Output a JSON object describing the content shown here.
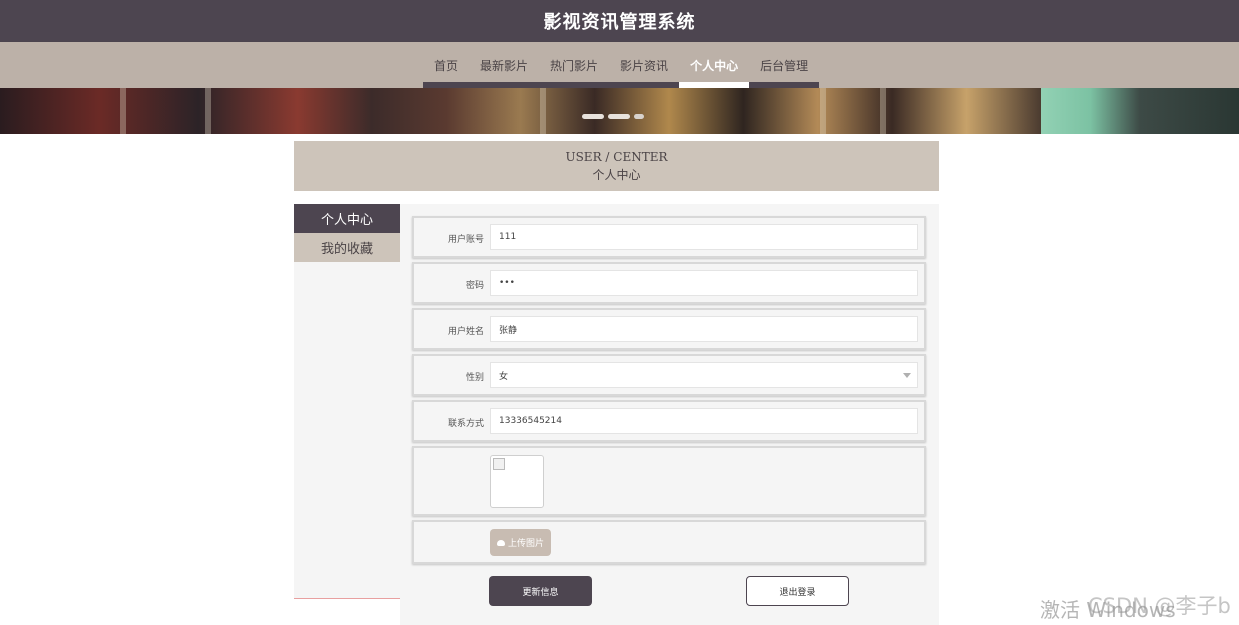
{
  "header": {
    "title": "影视资讯管理系统"
  },
  "nav": {
    "items": [
      {
        "label": "首页"
      },
      {
        "label": "最新影片"
      },
      {
        "label": "热门影片"
      },
      {
        "label": "影片资讯"
      },
      {
        "label": "个人中心"
      },
      {
        "label": "后台管理"
      }
    ],
    "active_index": 4
  },
  "banner": {
    "indicator_count": 3
  },
  "center": {
    "title_en": "USER / CENTER",
    "title_zh": "个人中心"
  },
  "sidebar": {
    "items": [
      {
        "label": "个人中心"
      },
      {
        "label": "我的收藏"
      }
    ]
  },
  "form": {
    "account": {
      "label": "用户账号",
      "value": "111"
    },
    "password": {
      "label": "密码",
      "value": "•••"
    },
    "name": {
      "label": "用户姓名",
      "value": "张静"
    },
    "gender": {
      "label": "性别",
      "value": "女"
    },
    "phone": {
      "label": "联系方式",
      "value": "13336545214"
    },
    "upload_label": "上传图片"
  },
  "actions": {
    "update_label": "更新信息",
    "logout_label": "退出登录"
  },
  "overlay": {
    "windows_text": "激活 Windows",
    "csdn_text": "CSDN @李子b"
  },
  "colors": {
    "header_bg": "#4d4550",
    "nav_bg": "#bcb1a8",
    "panel_bg": "#cdc4ba"
  }
}
